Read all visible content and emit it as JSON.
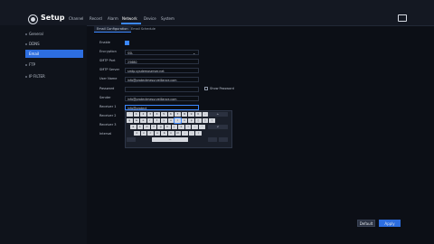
{
  "app": {
    "title": "Setup"
  },
  "nav": [
    "Channel",
    "Record",
    "Alarm",
    "Network",
    "Device",
    "System"
  ],
  "sidebar": [
    "General",
    "DDNS",
    "Email",
    "FTP",
    "IP FILTER"
  ],
  "subtabs": [
    "Email Configuration",
    "Email Schedule"
  ],
  "form": {
    "enable_label": "Enable",
    "encryption_label": "Encryption",
    "encryption_value": "SSL",
    "smtp_port_label": "SMTP Port",
    "smtp_port_value": "25680",
    "smtp_server_label": "SMTP Server",
    "smtp_server_value": "smtp.sysdemoserver.net",
    "user_name_label": "User Name",
    "user_name_value": "info@protectmesurveillance.com",
    "password_label": "Password",
    "show_password_label": "Show Password",
    "sender_label": "Sender",
    "sender_value": "info@protectmesurveillance.com",
    "receiver1_label": "Receiver 1",
    "receiver1_value": "info@protect",
    "receiver2_label": "Receiver 2",
    "receiver3_label": "Receiver 3",
    "interval_label": "Interval"
  },
  "keyboard": {
    "row1": [
      "`",
      "1",
      "2",
      "3",
      "4",
      "5",
      "6",
      "7",
      "8",
      "9",
      "0",
      "-",
      "="
    ],
    "row2": [
      "q",
      "w",
      "e",
      "r",
      "t",
      "y",
      "u",
      "i",
      "o",
      "p",
      "[",
      "]",
      "\\"
    ],
    "row3": [
      "a",
      "s",
      "d",
      "f",
      "g",
      "h",
      "j",
      "k",
      "l",
      ";",
      "'"
    ],
    "row4": [
      "z",
      "x",
      "c",
      "v",
      "b",
      "n",
      "m",
      ",",
      ".",
      "/"
    ],
    "backspace": "←",
    "space": "—",
    "enter": "↵"
  },
  "buttons": {
    "default": "Default",
    "apply": "Apply"
  }
}
